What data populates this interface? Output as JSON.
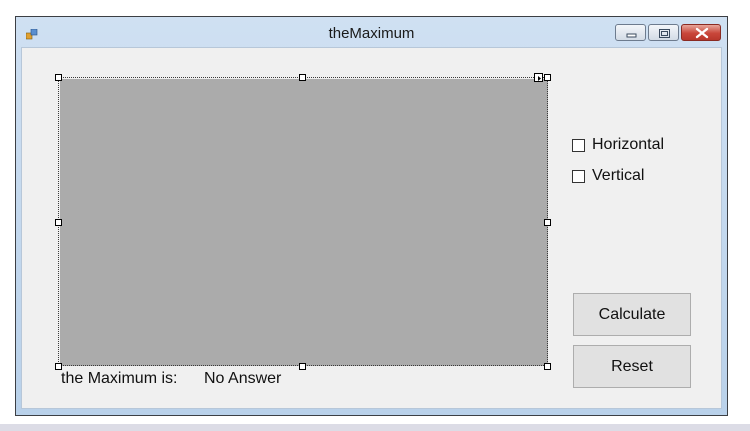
{
  "window": {
    "title": "theMaximum",
    "app_icon": "winforms-app-icon",
    "controls": [
      "minimize-icon",
      "maximize-icon",
      "close-icon"
    ]
  },
  "panel": {
    "color": "#ababab"
  },
  "checkboxes": [
    {
      "label": "Horizontal",
      "checked": false
    },
    {
      "label": "Vertical",
      "checked": false
    }
  ],
  "buttons": {
    "calculate_label": "Calculate",
    "reset_label": "Reset"
  },
  "result": {
    "label": "the Maximum is:",
    "value": "No Answer"
  }
}
